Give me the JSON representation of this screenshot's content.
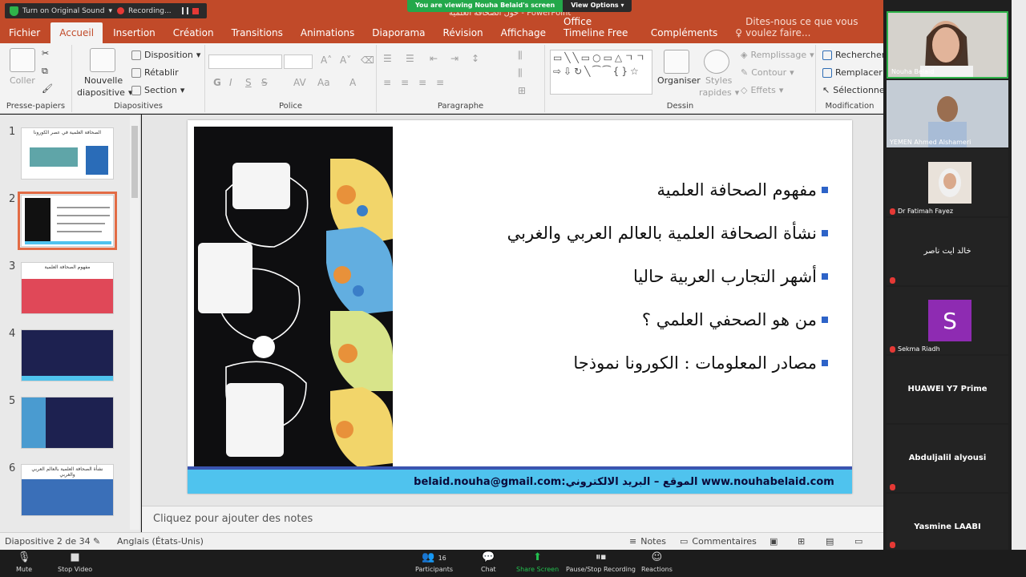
{
  "zoom_top": {
    "original_sound": "Turn on Original Sound",
    "recording": "Recording...",
    "viewing_banner": "You are viewing Nouha Belaid's screen",
    "view_options": "View Options",
    "ppt_title": "حول الصحافة العلمية - PowerPoint"
  },
  "ribbon_tabs": [
    "Fichier",
    "Accueil",
    "Insertion",
    "Création",
    "Transitions",
    "Animations",
    "Diaporama",
    "Révision",
    "Affichage",
    "Office Timeline Free",
    "Compléments"
  ],
  "tell_me": "Dites-nous ce que vous voulez faire...",
  "ribbon": {
    "coller": "Coller",
    "nouvelle": "Nouvelle",
    "diapositive": "diapositive",
    "disposition": "Disposition",
    "retablir": "Rétablir",
    "section": "Section",
    "organiser": "Organiser",
    "styles": "Styles",
    "rapides": "rapides",
    "remplissage": "Remplissage",
    "contour": "Contour",
    "effets": "Effets",
    "rechercher": "Rechercher",
    "remplacer": "Remplacer",
    "selectionner": "Sélectionner",
    "groups": {
      "presse": "Presse-papiers",
      "diapositives": "Diapositives",
      "police": "Police",
      "paragraphe": "Paragraphe",
      "dessin": "Dessin",
      "modification": "Modification"
    },
    "font_buttons": [
      "G",
      "I",
      "S",
      "S",
      "AV",
      "Aa",
      "A"
    ]
  },
  "thumbnails": [
    {
      "num": "1",
      "title": "الصحافة العلمية في عصر الكورونا"
    },
    {
      "num": "2",
      "title": ""
    },
    {
      "num": "3",
      "title": "مفهوم الصحافة العلمية"
    },
    {
      "num": "4",
      "title": ""
    },
    {
      "num": "5",
      "title": ""
    },
    {
      "num": "6",
      "title": "نشأة الصحافة العلمية بالعالم العربي والغربي"
    }
  ],
  "slide": {
    "bullets": [
      "مفهوم الصحافة العلمية",
      "نشأة الصحافة العلمية بالعالم العربي والغربي",
      "أشهر التجارب العربية حاليا",
      "من هو الصحفي العلمي ؟",
      "مصادر المعلومات : الكورونا نموذجا"
    ],
    "footer": "belaid.nouha@gmail.com:الموقع – البريد الالكتروني www.nouhabelaid.com"
  },
  "notes_placeholder": "Cliquez pour ajouter des notes",
  "status": {
    "slide_counter": "Diapositive 2 de 34",
    "language": "Anglais (États-Unis)",
    "notes": "Notes",
    "comments": "Commentaires"
  },
  "zoom_controls": {
    "mute": "Mute",
    "stop_video": "Stop Video",
    "participants": "Participants",
    "participants_count": "16",
    "chat": "Chat",
    "share_screen": "Share Screen",
    "pause_recording": "Pause/Stop Recording",
    "reactions": "Reactions"
  },
  "participants": [
    {
      "name": "Nouha Belaid"
    },
    {
      "name": "YEMEN Ahmed Alshameri"
    },
    {
      "name": "Dr Fatimah Fayez"
    },
    {
      "name": "خالد ايت ناصر"
    },
    {
      "name": "Sekma Riadh",
      "avatar": "S"
    },
    {
      "name": "HUAWEI Y7 Prime"
    },
    {
      "name": "Abduljalil alyousi"
    },
    {
      "name": "Yasmine LAABI"
    }
  ],
  "colors": {
    "ppt_accent": "#c14a29",
    "zoom_green": "#23a84a",
    "slide_blue": "#2d63c8",
    "footer_cyan": "#4fc3ee"
  }
}
